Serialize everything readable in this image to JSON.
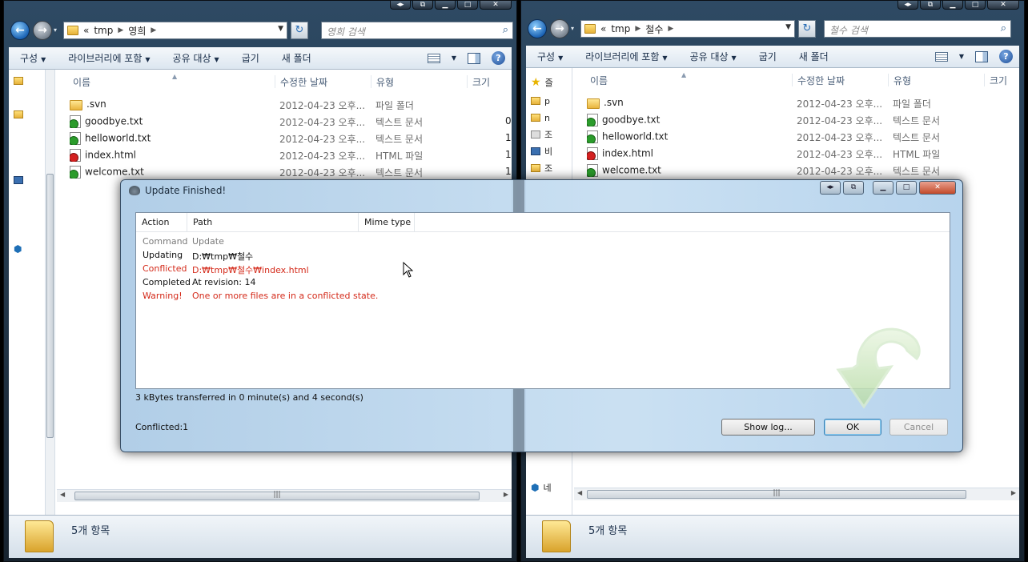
{
  "left": {
    "breadcrumb": {
      "prefix": "«",
      "items": [
        "tmp",
        "영희"
      ]
    },
    "search_placeholder": "영희 검색",
    "status_count": "5개 항목"
  },
  "right": {
    "breadcrumb": {
      "prefix": "«",
      "items": [
        "tmp",
        "철수"
      ]
    },
    "search_placeholder": "철수 검색",
    "status_count": "5개 항목",
    "nav_items": [
      "즐",
      "p",
      "n",
      "조",
      "비",
      "조",
      "네"
    ]
  },
  "toolbar": {
    "organize": "구성",
    "include_library": "라이브러리에 포함",
    "share_with": "공유 대상",
    "burn": "굽기",
    "new_folder": "새 폴더"
  },
  "columns": {
    "name": "이름",
    "date": "수정한 날짜",
    "type": "유형",
    "size": "크기"
  },
  "files": [
    {
      "name": ".svn",
      "date": "2012-04-23 오후...",
      "type": "파일 폴더",
      "size": "",
      "icon": "folder-icon"
    },
    {
      "name": "goodbye.txt",
      "date": "2012-04-23 오후...",
      "type": "텍스트 문서",
      "size": "0",
      "icon": "svn-ok-icon"
    },
    {
      "name": "helloworld.txt",
      "date": "2012-04-23 오후...",
      "type": "텍스트 문서",
      "size": "1",
      "icon": "svn-ok-icon"
    },
    {
      "name": "index.html",
      "date": "2012-04-23 오후...",
      "type": "HTML 파일",
      "size": "1",
      "icon": "svn-conflict-icon"
    },
    {
      "name": "welcome.txt",
      "date": "2012-04-23 오후...",
      "type": "텍스트 문서",
      "size": "1",
      "icon": "svn-ok-icon"
    }
  ],
  "dialog": {
    "title": "Update Finished!",
    "columns": {
      "action": "Action",
      "path": "Path",
      "mime": "Mime type"
    },
    "rows": [
      {
        "action": "Command",
        "path": "Update",
        "style": "gray"
      },
      {
        "action": "Updating",
        "path": "D:₩tmp₩철수",
        "style": "norm"
      },
      {
        "action": "Conflicted",
        "path": "D:₩tmp₩철수₩index.html",
        "style": "red"
      },
      {
        "action": "Completed",
        "path": "At revision: 14",
        "style": "norm"
      },
      {
        "action": "Warning!",
        "path": "One or more files are in a conflicted state.",
        "style": "red"
      }
    ],
    "transferred": "3 kBytes transferred in 0 minute(s) and 4 second(s)",
    "conflicted": "Conflicted:1",
    "show_log": "Show log...",
    "ok": "OK",
    "cancel": "Cancel"
  },
  "colors": {
    "conflict_red": "#d42a1a",
    "svn_ok_green": "#2b9b2b",
    "win_frame": "#2e4a64"
  }
}
